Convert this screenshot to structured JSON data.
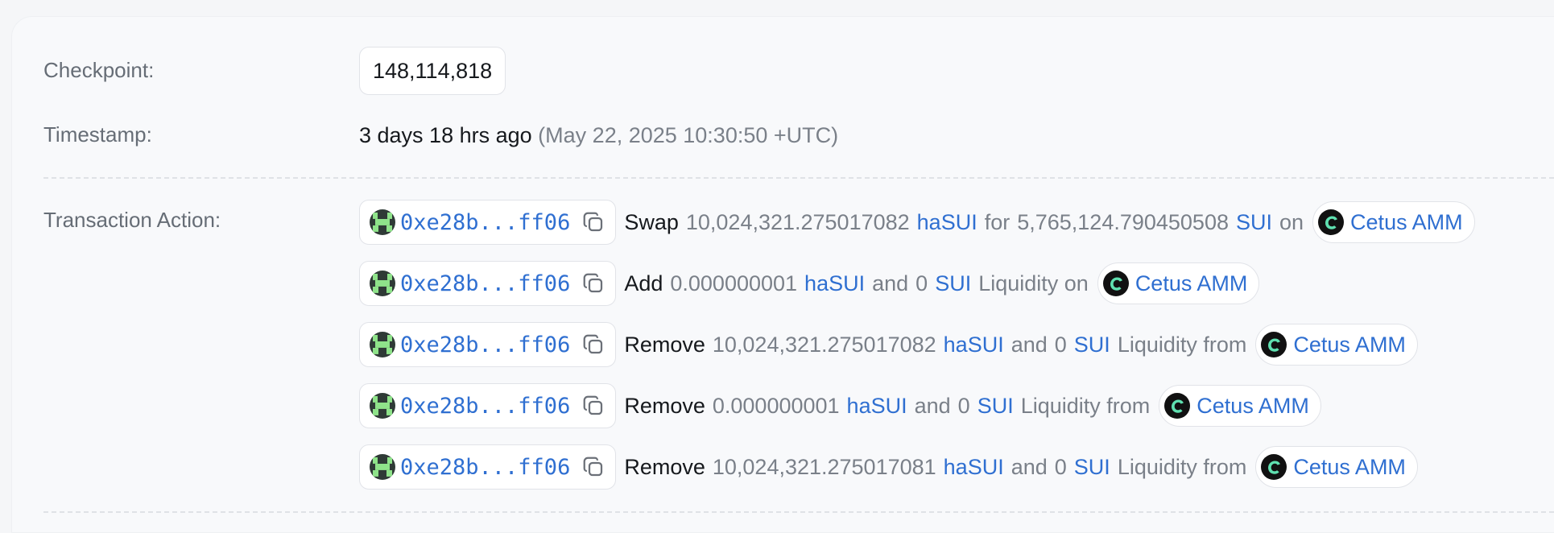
{
  "fields": {
    "checkpoint_label": "Checkpoint:",
    "checkpoint_value": "148,114,818",
    "timestamp_label": "Timestamp:",
    "timestamp_relative": "3 days 18 hrs ago",
    "timestamp_absolute": "(May 22, 2025 10:30:50 +UTC)",
    "action_label": "Transaction Action:"
  },
  "actions": [
    {
      "address": "0xe28b...ff06",
      "verb": "Swap",
      "amount1": "10,024,321.275017082",
      "token1": "haSUI",
      "connector": "for",
      "amount2": "5,765,124.790450508",
      "token2": "SUI",
      "tail": "on",
      "protocol": "Cetus AMM"
    },
    {
      "address": "0xe28b...ff06",
      "verb": "Add",
      "amount1": "0.000000001",
      "token1": "haSUI",
      "connector": "and",
      "amount2": "0",
      "token2": "SUI",
      "tail": "Liquidity on",
      "protocol": "Cetus AMM"
    },
    {
      "address": "0xe28b...ff06",
      "verb": "Remove",
      "amount1": "10,024,321.275017082",
      "token1": "haSUI",
      "connector": "and",
      "amount2": "0",
      "token2": "SUI",
      "tail": "Liquidity from",
      "protocol": "Cetus AMM"
    },
    {
      "address": "0xe28b...ff06",
      "verb": "Remove",
      "amount1": "0.000000001",
      "token1": "haSUI",
      "connector": "and",
      "amount2": "0",
      "token2": "SUI",
      "tail": "Liquidity from",
      "protocol": "Cetus AMM"
    },
    {
      "address": "0xe28b...ff06",
      "verb": "Remove",
      "amount1": "10,024,321.275017081",
      "token1": "haSUI",
      "connector": "and",
      "amount2": "0",
      "token2": "SUI",
      "tail": "Liquidity from",
      "protocol": "Cetus AMM"
    }
  ],
  "icons": {
    "avatar": "pixel-avatar-icon",
    "copy": "copy-icon",
    "protocol": "cetus-logo-icon"
  },
  "colors": {
    "link": "#2f6fd1",
    "muted": "#7a8089",
    "text": "#16191d",
    "border": "#e1e3e8"
  }
}
